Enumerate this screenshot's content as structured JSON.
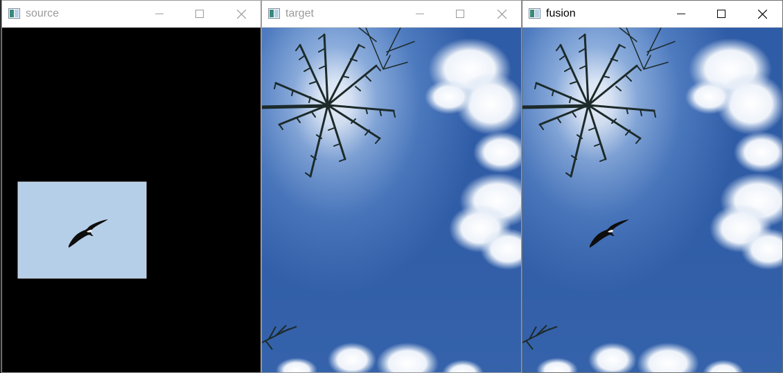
{
  "windows": [
    {
      "title": "source"
    },
    {
      "title": "target"
    },
    {
      "title": "fusion"
    }
  ],
  "colors": {
    "inactive_title": "#9a9a9a",
    "active_title": "#000000",
    "sky_top": "#2e5aa4",
    "sky_bottom": "#3a68ad",
    "patch_sky": "#b6cfe9"
  },
  "icons": [
    "app-icon",
    "minimize-icon",
    "maximize-icon",
    "close-icon"
  ]
}
